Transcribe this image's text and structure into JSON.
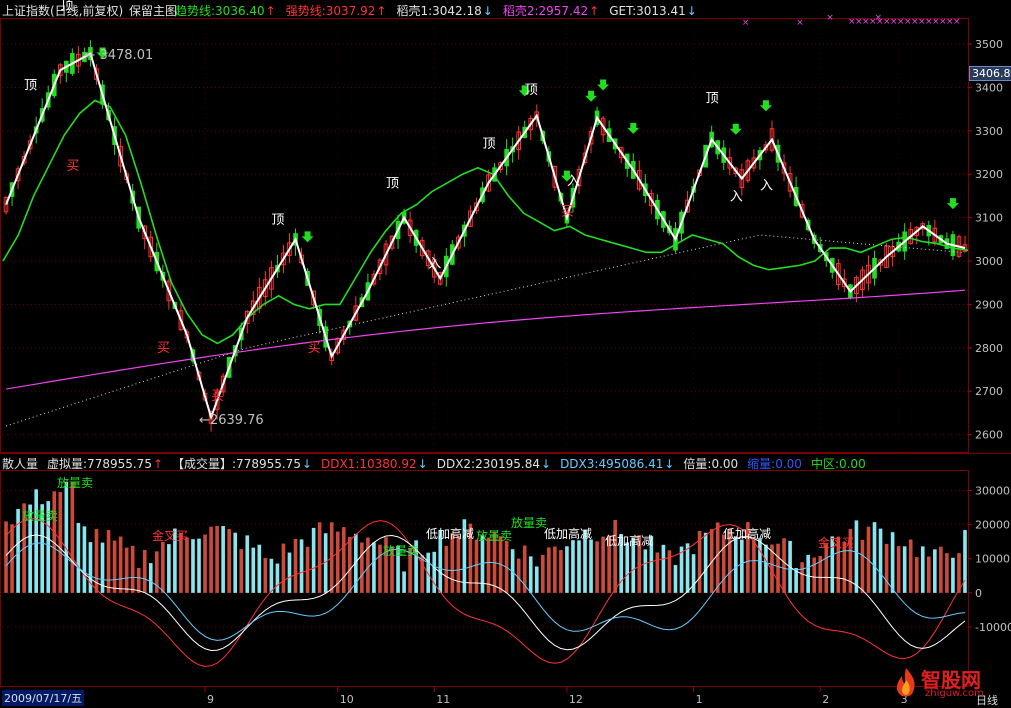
{
  "header_top": {
    "title": "上证指数(日线,前复权)",
    "mode": "保留主图",
    "items": [
      {
        "label": "趋势线:3036.40",
        "arrow": "↑",
        "color": "#22dd22"
      },
      {
        "label": "强势线:3037.92",
        "arrow": "↑",
        "color": "#ff3333"
      },
      {
        "label": "稻壳1:3042.18",
        "arrow": "↓",
        "color": "#e0e0e0"
      },
      {
        "label": "稻壳2:2957.42",
        "arrow": "↑",
        "color": "#ee44ee"
      },
      {
        "label": "GET:3013.41",
        "arrow": "↓",
        "color": "#e0e0e0"
      }
    ]
  },
  "header_bottom": {
    "items": [
      {
        "label": "散人量",
        "color": "#e0e0e0"
      },
      {
        "label": "虚拟量:778955.75",
        "arrow": "↑",
        "color": "#e0e0e0"
      },
      {
        "label": "【成交量】:778955.75",
        "arrow": "↓",
        "color": "#e0e0e0"
      },
      {
        "label": "DDX1:10380.92",
        "arrow": "↓",
        "color": "#ff3333"
      },
      {
        "label": "DDX2:230195.84",
        "arrow": "↓",
        "color": "#e0e0e0"
      },
      {
        "label": "DDX3:495086.41",
        "arrow": "↓",
        "color": "#66ccff"
      },
      {
        "label": "倍量:0.00",
        "color": "#e0e0e0"
      },
      {
        "label": "缩量:0.00",
        "color": "#3355ff"
      },
      {
        "label": "中区:0.00",
        "color": "#22dd22"
      }
    ]
  },
  "price_tag": "3406.8",
  "bottom_date": "2009/07/17/五",
  "period_label": "日线",
  "brand": {
    "name": "智股网",
    "url": "zhiguw.com"
  },
  "colors": {
    "up": "#ff3333",
    "down": "#22dd22",
    "pink": "#ee44ee",
    "white": "#ffffff",
    "cyan": "#66ddee",
    "grid": "#5a0000"
  },
  "chart_data": [
    {
      "type": "candlestick",
      "title": "",
      "y_ticks": [
        2600,
        2700,
        2800,
        2900,
        3000,
        3100,
        3200,
        3300,
        3400,
        3500
      ],
      "ylim": [
        2560,
        3560
      ],
      "x_ticks": [
        {
          "label": "9",
          "index": 33
        },
        {
          "label": "10",
          "index": 55
        },
        {
          "label": "11",
          "index": 71
        },
        {
          "label": "12",
          "index": 93
        },
        {
          "label": "1",
          "index": 114
        },
        {
          "label": "2",
          "index": 135
        },
        {
          "label": "3",
          "index": 148
        }
      ],
      "bar_count": 160,
      "annotations_text": [
        {
          "text": "顶",
          "i": 10,
          "y": 3580,
          "color": "#ffffff"
        },
        {
          "text": "顶",
          "i": 4,
          "y": 3395,
          "color": "#ffffff"
        },
        {
          "text": "← 3478.01",
          "i": 14,
          "y": 3465,
          "color": "#c0c0c0"
        },
        {
          "text": "买",
          "i": 11,
          "y": 3210,
          "color": "#ff3333"
        },
        {
          "text": "顶",
          "i": 45,
          "y": 3085,
          "color": "#ffffff"
        },
        {
          "text": "买",
          "i": 26,
          "y": 2790,
          "color": "#ff3333"
        },
        {
          "text": "买",
          "i": 35,
          "y": 2680,
          "color": "#ff3333"
        },
        {
          "text": "←2639.76",
          "i": 33,
          "y": 2625,
          "color": "#c0c0c0"
        },
        {
          "text": "买",
          "i": 51,
          "y": 2790,
          "color": "#ff3333"
        },
        {
          "text": "顶",
          "i": 64,
          "y": 3170,
          "color": "#ffffff"
        },
        {
          "text": "入",
          "i": 71,
          "y": 2985,
          "color": "#ffffff"
        },
        {
          "text": "顶",
          "i": 80,
          "y": 3260,
          "color": "#ffffff"
        },
        {
          "text": "顶",
          "i": 87,
          "y": 3385,
          "color": "#ffffff"
        },
        {
          "text": "入",
          "i": 94,
          "y": 3175,
          "color": "#ffffff"
        },
        {
          "text": "买",
          "i": 93,
          "y": 3105,
          "color": "#ff3333"
        },
        {
          "text": "顶",
          "i": 117,
          "y": 3365,
          "color": "#ffffff"
        },
        {
          "text": "入",
          "i": 121,
          "y": 3140,
          "color": "#ffffff"
        },
        {
          "text": "入",
          "i": 126,
          "y": 3165,
          "color": "#ffffff"
        }
      ],
      "series": [
        {
          "name": "趋势线",
          "color": "#22dd22",
          "values": [
            3000,
            3060,
            3150,
            3220,
            3290,
            3340,
            3370,
            3355,
            3290,
            3180,
            3060,
            2950,
            2880,
            2830,
            2810,
            2830,
            2870,
            2900,
            2920,
            2900,
            2890,
            2900,
            2900,
            2960,
            3020,
            3070,
            3110,
            3130,
            3160,
            3180,
            3200,
            3215,
            3200,
            3150,
            3110,
            3090,
            3070,
            3080,
            3060,
            3050,
            3040,
            3030,
            3020,
            3020,
            3040,
            3060,
            3050,
            3040,
            3010,
            2990,
            2980,
            2985,
            2990,
            3000,
            3030,
            3030,
            3020,
            3035,
            3050,
            3055,
            3045,
            3040,
            3030,
            3025
          ]
        }
      ],
      "points_label": "price"
    },
    {
      "type": "bar",
      "title": "",
      "y_ticks": [
        -10000,
        0,
        10000,
        20000,
        30000
      ],
      "ylim": [
        -27000,
        36000
      ],
      "annotations_text": [
        {
          "text": "放量卖",
          "x": 57,
          "y": 487,
          "color": "#22dd22"
        },
        {
          "text": "放量卖",
          "x": 22,
          "y": 520,
          "color": "#22dd22"
        },
        {
          "text": "金叉买",
          "x": 152,
          "y": 540,
          "color": "#ff3333"
        },
        {
          "text": "放量卖",
          "x": 383,
          "y": 555,
          "color": "#22dd22"
        },
        {
          "text": "低加高减",
          "x": 426,
          "y": 538,
          "color": "#ffffff"
        },
        {
          "text": "放量卖",
          "x": 476,
          "y": 540,
          "color": "#22dd22"
        },
        {
          "text": "放量卖",
          "x": 511,
          "y": 527,
          "color": "#22dd22"
        },
        {
          "text": "低加高减",
          "x": 544,
          "y": 538,
          "color": "#ffffff"
        },
        {
          "text": "低加高减",
          "x": 605,
          "y": 545,
          "color": "#ffffff"
        },
        {
          "text": "低加高减",
          "x": 723,
          "y": 538,
          "color": "#ffffff"
        },
        {
          "text": "金叉买",
          "x": 818,
          "y": 547,
          "color": "#ff3333"
        }
      ]
    }
  ]
}
